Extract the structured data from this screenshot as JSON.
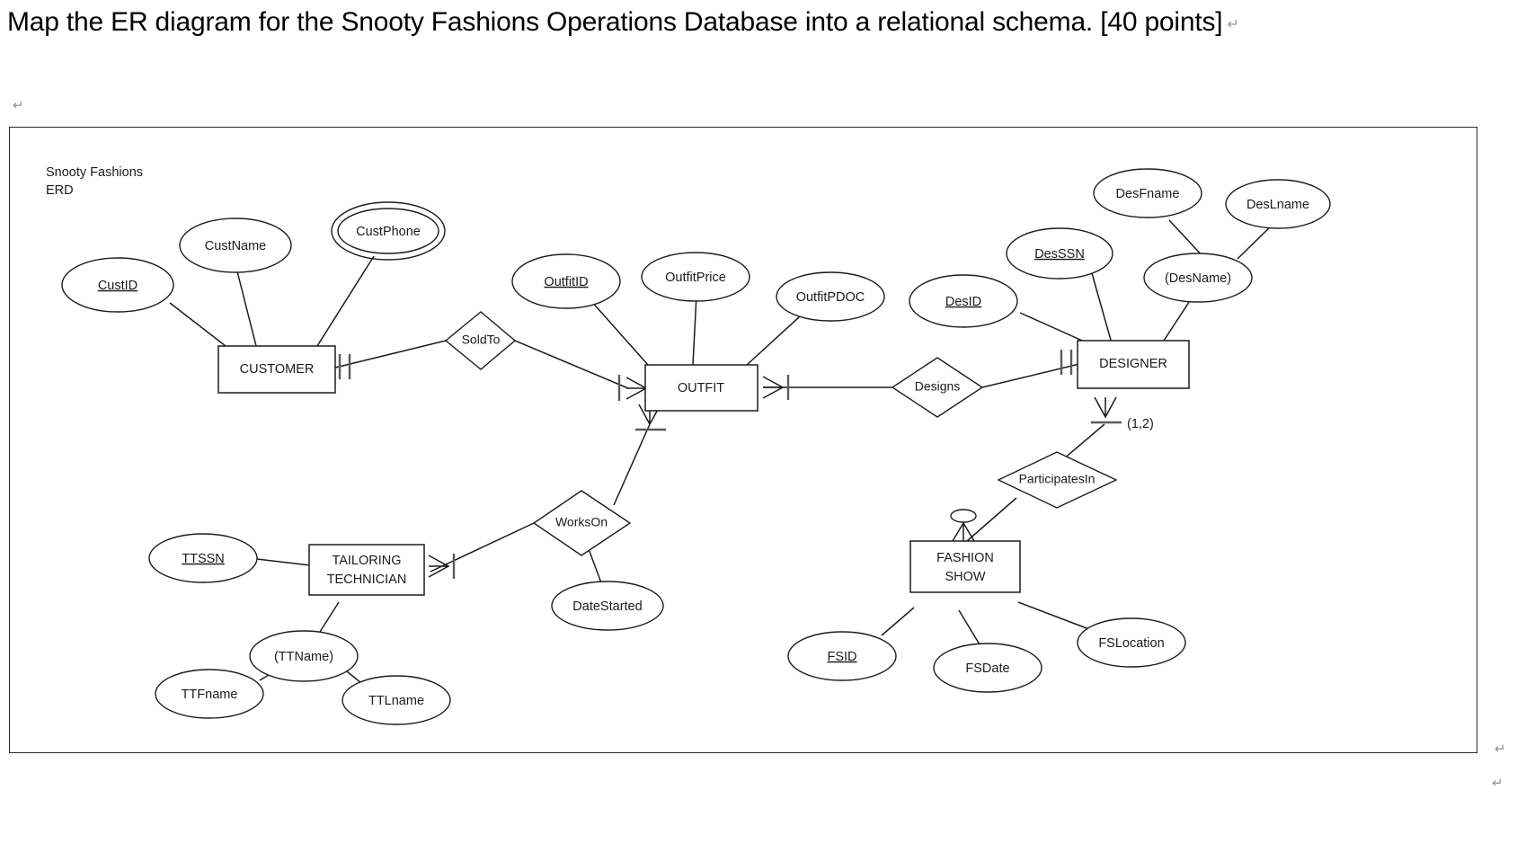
{
  "question": {
    "text": "Map the ER diagram for the Snooty Fashions Operations Database into a relational schema. [40 points]",
    "pilcrow": "↵"
  },
  "diagram": {
    "title_line1": "Snooty Fashions",
    "title_line2": "ERD",
    "entities": [
      {
        "id": "customer",
        "label": "CUSTOMER",
        "label2": ""
      },
      {
        "id": "outfit",
        "label": "OUTFIT",
        "label2": ""
      },
      {
        "id": "designer",
        "label": "DESIGNER",
        "label2": ""
      },
      {
        "id": "tailoring_technician",
        "label": "TAILORING",
        "label2": "TECHNICIAN"
      },
      {
        "id": "fashion_show",
        "label": "FASHION",
        "label2": "SHOW"
      }
    ],
    "attributes": [
      {
        "id": "custid",
        "label": "CustID",
        "owner": "CUSTOMER",
        "key": true,
        "multivalued": false,
        "composite": false
      },
      {
        "id": "custname",
        "label": "CustName",
        "owner": "CUSTOMER",
        "key": false,
        "multivalued": false,
        "composite": false
      },
      {
        "id": "custphone",
        "label": "CustPhone",
        "owner": "CUSTOMER",
        "key": false,
        "multivalued": true,
        "composite": false
      },
      {
        "id": "outfitid",
        "label": "OutfitID",
        "owner": "OUTFIT",
        "key": true,
        "multivalued": false,
        "composite": false
      },
      {
        "id": "outfitprice",
        "label": "OutfitPrice",
        "owner": "OUTFIT",
        "key": false,
        "multivalued": false,
        "composite": false
      },
      {
        "id": "outfitpdoc",
        "label": "OutfitPDOC",
        "owner": "OUTFIT",
        "key": false,
        "multivalued": false,
        "composite": false
      },
      {
        "id": "desid",
        "label": "DesID",
        "owner": "DESIGNER",
        "key": true,
        "multivalued": false,
        "composite": false
      },
      {
        "id": "desssn",
        "label": "DesSSN",
        "owner": "DESIGNER",
        "key": true,
        "multivalued": false,
        "composite": false
      },
      {
        "id": "desname",
        "label": "(DesName)",
        "owner": "DESIGNER",
        "key": false,
        "multivalued": false,
        "composite": true
      },
      {
        "id": "desfname",
        "label": "DesFname",
        "owner": "(DesName)",
        "key": false,
        "multivalued": false,
        "composite": false
      },
      {
        "id": "deslname",
        "label": "DesLname",
        "owner": "(DesName)",
        "key": false,
        "multivalued": false,
        "composite": false
      },
      {
        "id": "ttssn",
        "label": "TTSSN",
        "owner": "TAILORING TECHNICIAN",
        "key": true,
        "multivalued": false,
        "composite": false
      },
      {
        "id": "ttname",
        "label": "(TTName)",
        "owner": "TAILORING TECHNICIAN",
        "key": false,
        "multivalued": false,
        "composite": true
      },
      {
        "id": "ttfname",
        "label": "TTFname",
        "owner": "(TTName)",
        "key": false,
        "multivalued": false,
        "composite": false
      },
      {
        "id": "ttlname",
        "label": "TTLname",
        "owner": "(TTName)",
        "key": false,
        "multivalued": false,
        "composite": false
      },
      {
        "id": "datestarted",
        "label": "DateStarted",
        "owner": "WorksOn",
        "key": false,
        "multivalued": false,
        "composite": false
      },
      {
        "id": "fsid",
        "label": "FSID",
        "owner": "FASHION SHOW",
        "key": true,
        "multivalued": false,
        "composite": false
      },
      {
        "id": "fsdate",
        "label": "FSDate",
        "owner": "FASHION SHOW",
        "key": false,
        "multivalued": false,
        "composite": false
      },
      {
        "id": "fslocation",
        "label": "FSLocation",
        "owner": "FASHION SHOW",
        "key": false,
        "multivalued": false,
        "composite": false
      }
    ],
    "relationships": [
      {
        "id": "soldto",
        "label": "SoldTo",
        "from": "CUSTOMER",
        "to": "OUTFIT"
      },
      {
        "id": "designs",
        "label": "Designs",
        "from": "OUTFIT",
        "to": "DESIGNER"
      },
      {
        "id": "workson",
        "label": "WorksOn",
        "from": "TAILORING TECHNICIAN",
        "to": "OUTFIT"
      },
      {
        "id": "participatesin",
        "label": "ParticipatesIn",
        "from": "DESIGNER",
        "to": "FASHION SHOW"
      }
    ],
    "cardinality_labels": [
      {
        "id": "designer-participates-card",
        "label": "(1,2)"
      }
    ]
  }
}
